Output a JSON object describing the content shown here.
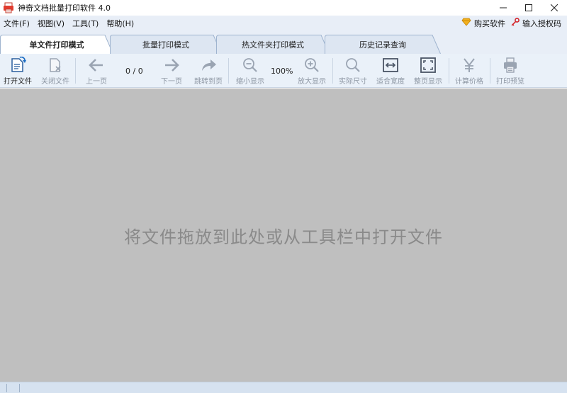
{
  "window": {
    "title": "神奇文档批量打印软件 4.0"
  },
  "menu": {
    "file": "文件(F)",
    "view": "视图(V)",
    "tools": "工具(T)",
    "help": "帮助(H)",
    "buy": "购买软件",
    "license": "输入授权码"
  },
  "tabs": [
    "单文件打印模式",
    "批量打印模式",
    "热文件夹打印模式",
    "历史记录查询"
  ],
  "toolbar": {
    "open": "打开文件",
    "close": "关闭文件",
    "prev": "上一页",
    "page_counter": "0 / 0",
    "next": "下一页",
    "goto": "跳转到页",
    "zoom_out": "缩小显示",
    "zoom_level": "100%",
    "zoom_in": "放大显示",
    "actual_size": "实际尺寸",
    "fit_width": "适合宽度",
    "fit_page": "整页显示",
    "price": "计算价格",
    "preview": "打印预览"
  },
  "workspace": {
    "hint": "将文件拖放到此处或从工具栏中打开文件"
  },
  "colors": {
    "accent": "#1f6fc5",
    "disabled_icon": "#9aa4b2",
    "workspace_bg": "#bfbfbf",
    "toolbar_bg": "#eaf1f9"
  }
}
